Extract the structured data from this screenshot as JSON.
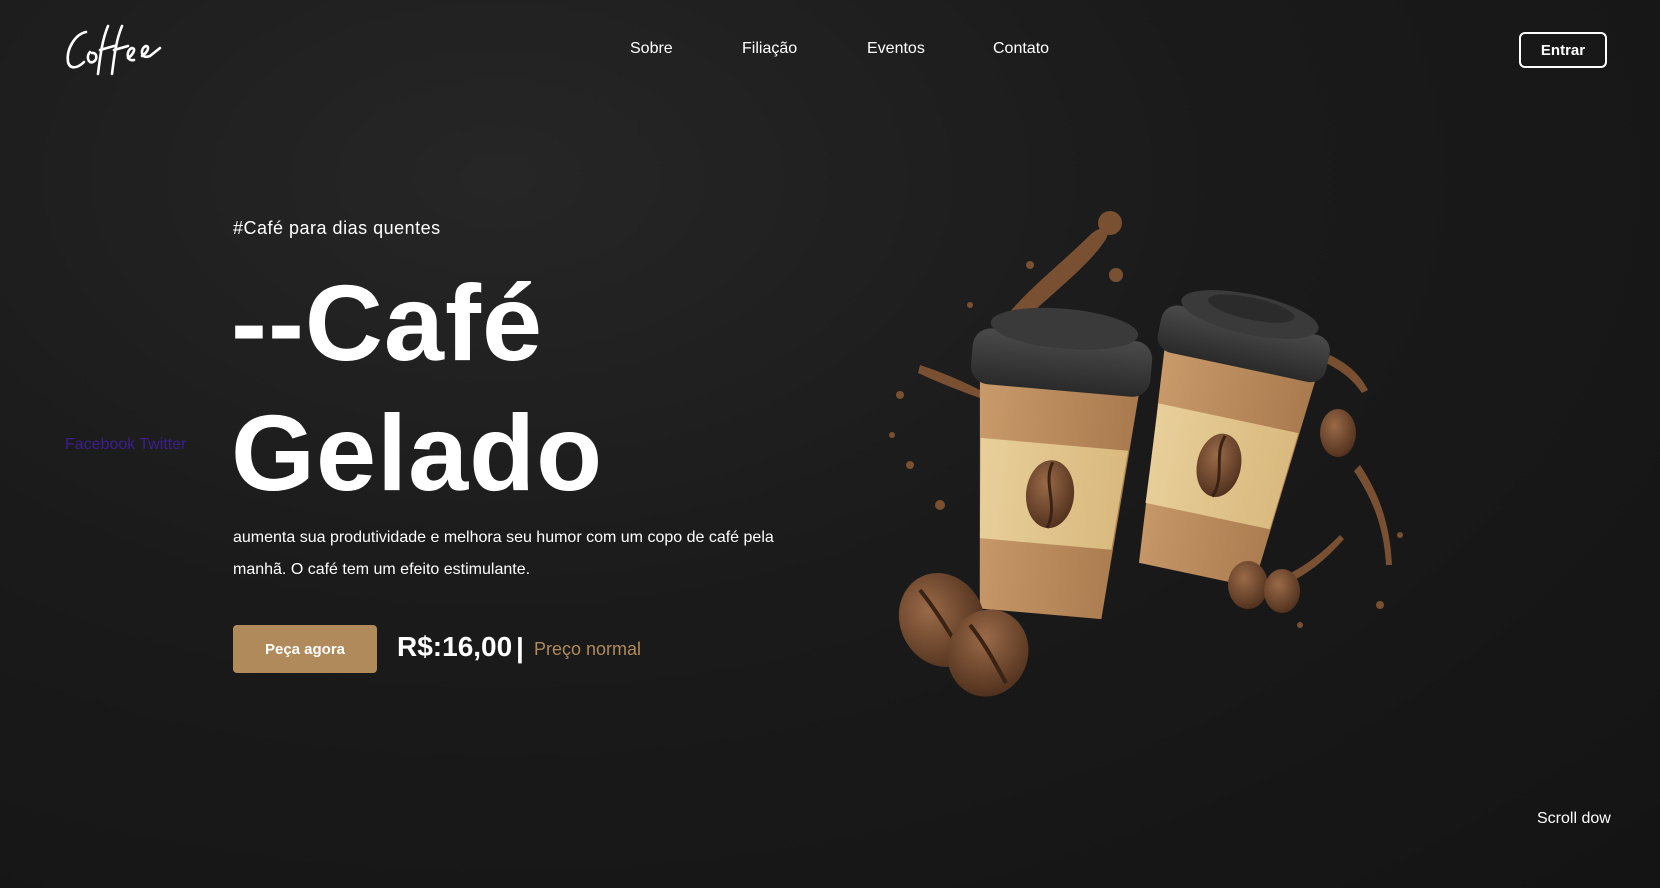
{
  "brand": {
    "logo_text": "Coffee"
  },
  "nav": {
    "items": [
      "Sobre",
      "Filiação",
      "Eventos",
      "Contato"
    ],
    "login_label": "Entrar"
  },
  "social": {
    "facebook": "Facebook",
    "twitter": "Twitter"
  },
  "hero": {
    "tagline": "#Café para dias quentes",
    "title_line1": "--Café",
    "title_line2": "Gelado",
    "description": "aumenta sua produtividade e melhora seu humor com um copo de café pela manhã. O café tem um efeito estimulante.",
    "order_button": "Peça agora",
    "price": "R$:16,00",
    "price_separator": "|",
    "price_label": "Preço normal"
  },
  "footer": {
    "scroll_label": "Scroll dow"
  },
  "colors": {
    "accent": "#b08a5a",
    "background": "#1a1a1a",
    "social_link": "#3c1e8e"
  },
  "icons": {
    "hero_illustration": "coffee-cups-illustration"
  }
}
